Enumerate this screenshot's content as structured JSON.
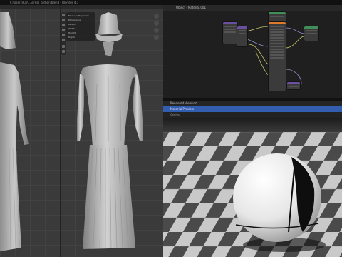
{
  "titlebar": {
    "text": "C:\\Users\\Kai\\...\\dress_turban.blend - Blender 4.1"
  },
  "viewport": {
    "panel_lines": [
      "Measure/Properties",
      "Dimensions",
      "Length",
      "Width",
      "Height",
      "Depth"
    ],
    "tools": [
      "select-tool",
      "cursor-tool",
      "move-tool",
      "rotate-tool",
      "scale-tool",
      "transform-tool",
      "annotate-tool",
      "measure-tool"
    ]
  },
  "node_editor": {
    "header": "Object  ·  Material.001"
  },
  "render": {
    "header": "Rendered Viewport",
    "subheader": "Material Preview",
    "info": "Cycles"
  },
  "colors": {
    "accent": "#335eb0",
    "node_orange": "#e07b2c",
    "node_green": "#3f8f5a",
    "node_purple": "#6b4fa0"
  }
}
